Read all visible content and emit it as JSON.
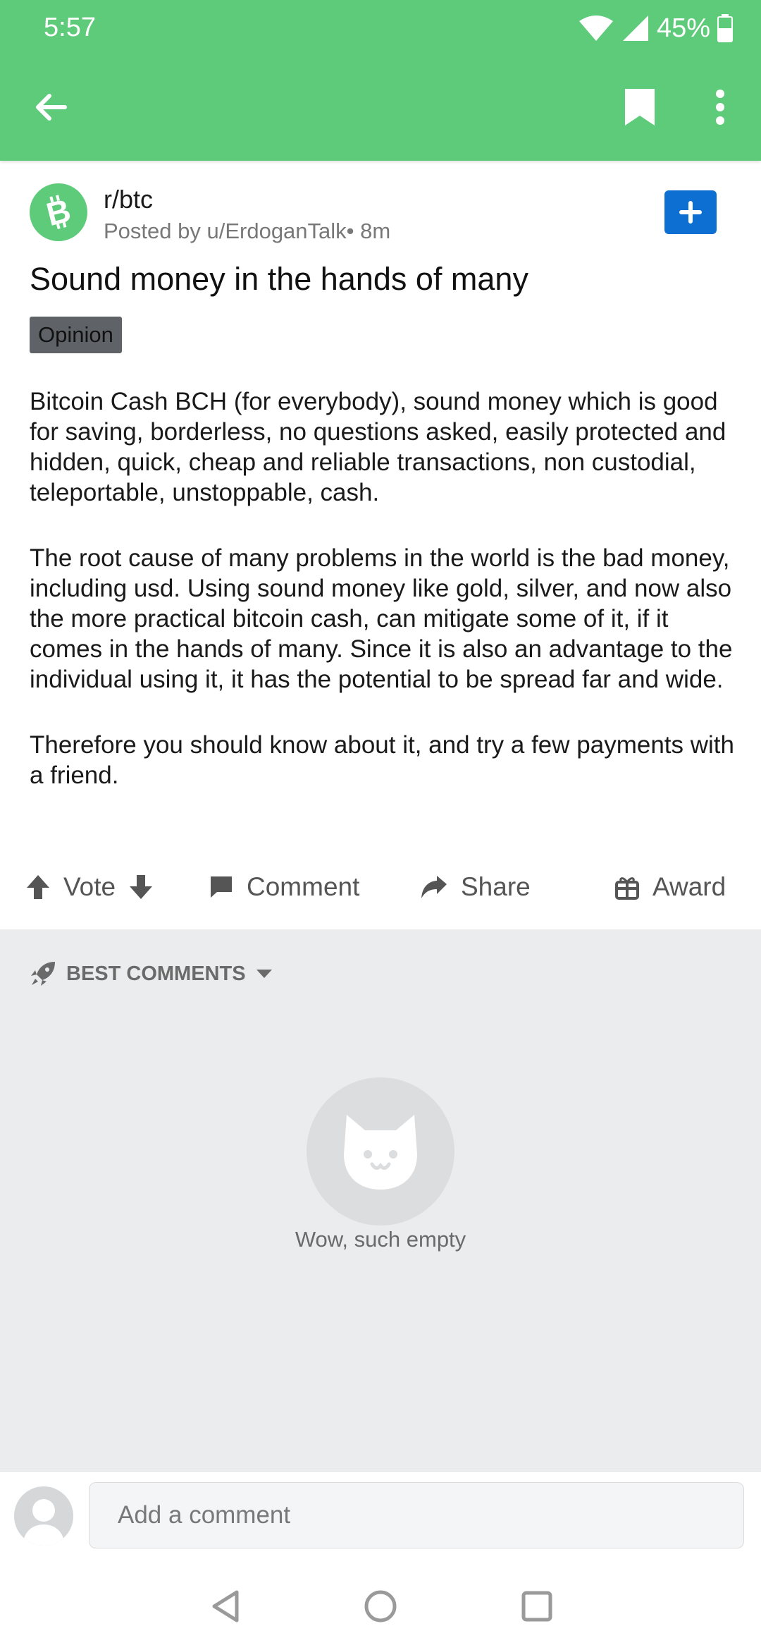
{
  "status_bar": {
    "time": "5:57",
    "battery": "45%"
  },
  "post": {
    "subreddit": "r/btc",
    "posted_by": "Posted by u/ErdoganTalk",
    "age": "• 8m",
    "title": "Sound money in the hands of many",
    "flair": "Opinion",
    "body": [
      "Bitcoin Cash BCH (for everybody), sound money which is good for saving, borderless, no questions asked, easily protected and hidden, quick, cheap and reliable transactions, non custodial, teleportable, unstoppable, cash.",
      "The root cause of many problems in the world is the bad money, including usd. Using sound money like gold, silver, and now also the more practical bitcoin cash, can mitigate some of it, if it comes in the hands of many. Since it is also an advantage to the individual using it, it has the potential to be spread far and wide.",
      "Therefore you should know about it, and try a few payments with a friend."
    ]
  },
  "actions": {
    "vote": "Vote",
    "comment": "Comment",
    "share": "Share",
    "award": "Award"
  },
  "comments": {
    "sort_label": "BEST COMMENTS",
    "empty_text": "Wow, such empty"
  },
  "comment_input": {
    "placeholder": "Add a comment"
  },
  "colors": {
    "app_bar": "#5ECB7A",
    "join_button": "#0D6FD1",
    "flair_bg": "#5F6368",
    "comments_bg": "#EBECEE"
  }
}
